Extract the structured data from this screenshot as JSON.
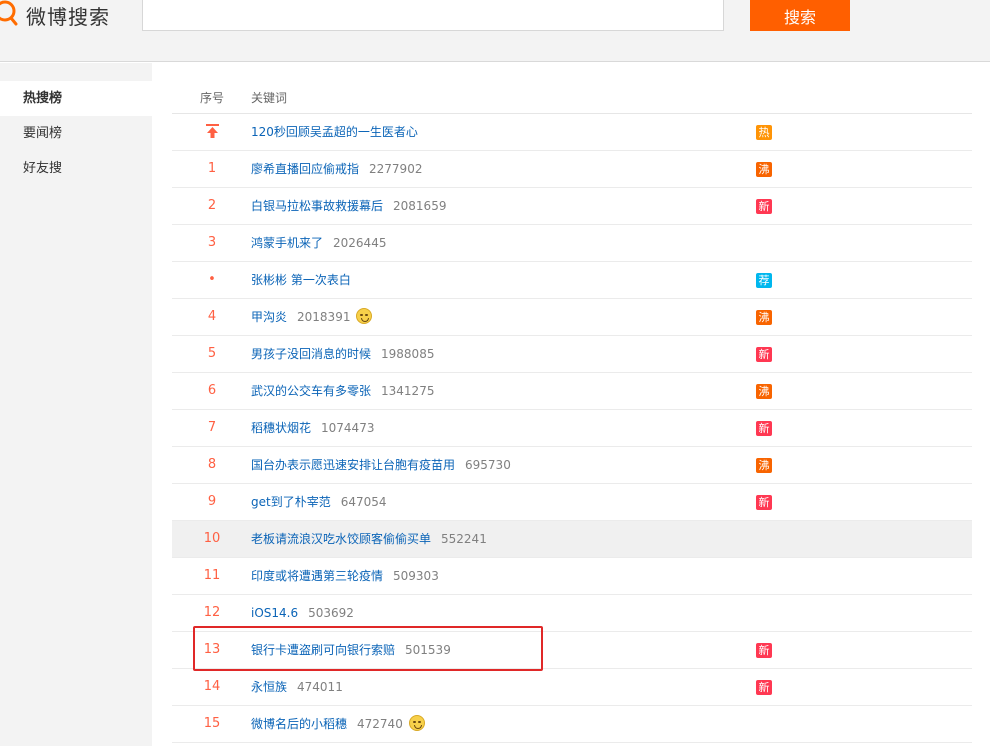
{
  "header": {
    "logo_text": "微博搜索",
    "search_value": "",
    "search_button": "搜索"
  },
  "sidebar": {
    "items": [
      {
        "label": "热搜榜",
        "active": true
      },
      {
        "label": "要闻榜",
        "active": false
      },
      {
        "label": "好友搜",
        "active": false
      }
    ]
  },
  "table": {
    "headers": {
      "rank": "序号",
      "keyword": "关键词"
    },
    "rows": [
      {
        "rank": "top-icon",
        "keyword": "120秒回顾吴孟超的一生医者心",
        "count": "",
        "emoji": false,
        "tag": "热",
        "tag_color": "#ff9406",
        "highlight": false
      },
      {
        "rank": "1",
        "keyword": "廖希直播回应偷戒指",
        "count": "2277902",
        "emoji": false,
        "tag": "沸",
        "tag_color": "#f86400",
        "highlight": false
      },
      {
        "rank": "2",
        "keyword": "白银马拉松事故救援幕后",
        "count": "2081659",
        "emoji": false,
        "tag": "新",
        "tag_color": "#ff3852",
        "highlight": false
      },
      {
        "rank": "3",
        "keyword": "鸿蒙手机来了",
        "count": "2026445",
        "emoji": false,
        "tag": "",
        "tag_color": "",
        "highlight": false
      },
      {
        "rank": "•",
        "keyword": "张彬彬 第一次表白",
        "count": "",
        "emoji": false,
        "tag": "荐",
        "tag_color": "#00b7ee",
        "highlight": false
      },
      {
        "rank": "4",
        "keyword": "甲沟炎",
        "count": "2018391",
        "emoji": true,
        "tag": "沸",
        "tag_color": "#f86400",
        "highlight": false
      },
      {
        "rank": "5",
        "keyword": "男孩子没回消息的时候",
        "count": "1988085",
        "emoji": false,
        "tag": "新",
        "tag_color": "#ff3852",
        "highlight": false
      },
      {
        "rank": "6",
        "keyword": "武汉的公交车有多零张",
        "count": "1341275",
        "emoji": false,
        "tag": "沸",
        "tag_color": "#f86400",
        "highlight": false
      },
      {
        "rank": "7",
        "keyword": "稻穗状烟花",
        "count": "1074473",
        "emoji": false,
        "tag": "新",
        "tag_color": "#ff3852",
        "highlight": false
      },
      {
        "rank": "8",
        "keyword": "国台办表示愿迅速安排让台胞有疫苗用",
        "count": "695730",
        "emoji": false,
        "tag": "沸",
        "tag_color": "#f86400",
        "highlight": false
      },
      {
        "rank": "9",
        "keyword": "get到了朴宰范",
        "count": "647054",
        "emoji": false,
        "tag": "新",
        "tag_color": "#ff3852",
        "highlight": false
      },
      {
        "rank": "10",
        "keyword": "老板请流浪汉吃水饺顾客偷偷买单",
        "count": "552241",
        "emoji": false,
        "tag": "",
        "tag_color": "",
        "highlight": true
      },
      {
        "rank": "11",
        "keyword": "印度或将遭遇第三轮疫情",
        "count": "509303",
        "emoji": false,
        "tag": "",
        "tag_color": "",
        "highlight": false
      },
      {
        "rank": "12",
        "keyword": "iOS14.6",
        "count": "503692",
        "emoji": false,
        "tag": "",
        "tag_color": "",
        "highlight": false
      },
      {
        "rank": "13",
        "keyword": "银行卡遭盗刷可向银行索赔",
        "count": "501539",
        "emoji": false,
        "tag": "新",
        "tag_color": "#ff3852",
        "highlight": false
      },
      {
        "rank": "14",
        "keyword": "永恒族",
        "count": "474011",
        "emoji": false,
        "tag": "新",
        "tag_color": "#ff3852",
        "highlight": false
      },
      {
        "rank": "15",
        "keyword": "微博名后的小稻穗",
        "count": "472740",
        "emoji": true,
        "tag": "",
        "tag_color": "",
        "highlight": false
      }
    ]
  },
  "icons": {
    "logo": "search-magnifier-icon",
    "top_pin": "arrow-up-to-top-icon",
    "emoji": "smiling-face-icon"
  }
}
